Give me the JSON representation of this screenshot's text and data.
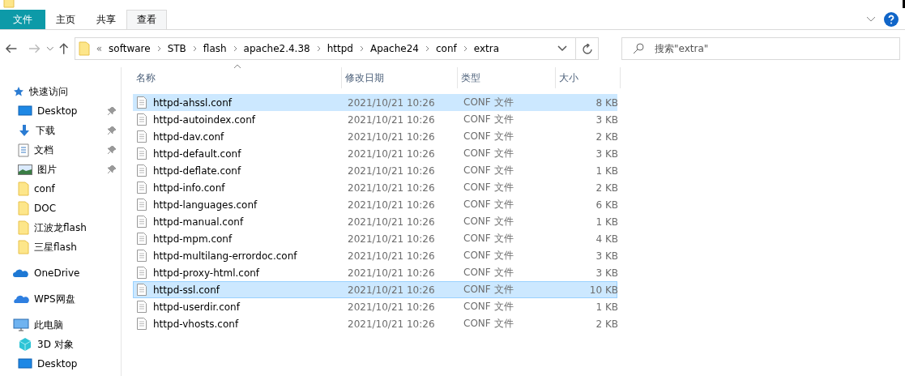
{
  "ribbon": {
    "tabs": [
      {
        "label": "文件",
        "kind": "file",
        "selected": false
      },
      {
        "label": "主页",
        "kind": "tab",
        "selected": false
      },
      {
        "label": "共享",
        "kind": "tab",
        "selected": false
      },
      {
        "label": "查看",
        "kind": "tab",
        "selected": true
      }
    ]
  },
  "address": {
    "prefix": "«",
    "path": [
      "software",
      "STB",
      "flash",
      "apache2.4.38",
      "httpd",
      "Apache24",
      "conf",
      "extra"
    ]
  },
  "search": {
    "placeholder": "搜索\"extra\""
  },
  "sidebar": {
    "groups": [
      {
        "label": "快速访问",
        "kind": "star",
        "children": [
          {
            "label": "Desktop",
            "kind": "desktop",
            "pinned": true
          },
          {
            "label": "下载",
            "kind": "download",
            "pinned": true
          },
          {
            "label": "文档",
            "kind": "document",
            "pinned": true
          },
          {
            "label": "图片",
            "kind": "picture",
            "pinned": true
          },
          {
            "label": "conf",
            "kind": "folder",
            "pinned": false
          },
          {
            "label": "DOC",
            "kind": "folder",
            "pinned": false
          },
          {
            "label": "江波龙flash",
            "kind": "folder",
            "pinned": false
          },
          {
            "label": "三星flash",
            "kind": "folder",
            "pinned": false
          }
        ]
      },
      {
        "label": "OneDrive",
        "kind": "cloud"
      },
      {
        "label": "WPS网盘",
        "kind": "cloud2"
      },
      {
        "label": "此电脑",
        "kind": "pc",
        "children": [
          {
            "label": "3D 对象",
            "kind": "cube",
            "pinned": false
          },
          {
            "label": "Desktop",
            "kind": "desktop",
            "pinned": false
          }
        ]
      }
    ]
  },
  "table": {
    "columns": [
      "名称",
      "修改日期",
      "类型",
      "大小"
    ],
    "rows": [
      {
        "name": "httpd-ahssl.conf",
        "date": "2021/10/21 10:26",
        "type": "CONF 文件",
        "size": "8 KB",
        "selected": true,
        "focused": false
      },
      {
        "name": "httpd-autoindex.conf",
        "date": "2021/10/21 10:26",
        "type": "CONF 文件",
        "size": "3 KB",
        "selected": false,
        "focused": false
      },
      {
        "name": "httpd-dav.conf",
        "date": "2021/10/21 10:26",
        "type": "CONF 文件",
        "size": "2 KB",
        "selected": false,
        "focused": false
      },
      {
        "name": "httpd-default.conf",
        "date": "2021/10/21 10:26",
        "type": "CONF 文件",
        "size": "3 KB",
        "selected": false,
        "focused": false
      },
      {
        "name": "httpd-deflate.conf",
        "date": "2021/10/21 10:26",
        "type": "CONF 文件",
        "size": "1 KB",
        "selected": false,
        "focused": false
      },
      {
        "name": "httpd-info.conf",
        "date": "2021/10/21 10:26",
        "type": "CONF 文件",
        "size": "2 KB",
        "selected": false,
        "focused": false
      },
      {
        "name": "httpd-languages.conf",
        "date": "2021/10/21 10:26",
        "type": "CONF 文件",
        "size": "6 KB",
        "selected": false,
        "focused": false
      },
      {
        "name": "httpd-manual.conf",
        "date": "2021/10/21 10:26",
        "type": "CONF 文件",
        "size": "1 KB",
        "selected": false,
        "focused": false
      },
      {
        "name": "httpd-mpm.conf",
        "date": "2021/10/21 10:26",
        "type": "CONF 文件",
        "size": "4 KB",
        "selected": false,
        "focused": false
      },
      {
        "name": "httpd-multilang-errordoc.conf",
        "date": "2021/10/21 10:26",
        "type": "CONF 文件",
        "size": "3 KB",
        "selected": false,
        "focused": false
      },
      {
        "name": "httpd-proxy-html.conf",
        "date": "2021/10/21 10:26",
        "type": "CONF 文件",
        "size": "3 KB",
        "selected": false,
        "focused": false
      },
      {
        "name": "httpd-ssl.conf",
        "date": "2021/10/21 10:26",
        "type": "CONF 文件",
        "size": "10 KB",
        "selected": true,
        "focused": true
      },
      {
        "name": "httpd-userdir.conf",
        "date": "2021/10/21 10:26",
        "type": "CONF 文件",
        "size": "1 KB",
        "selected": false,
        "focused": false
      },
      {
        "name": "httpd-vhosts.conf",
        "date": "2021/10/21 10:26",
        "type": "CONF 文件",
        "size": "2 KB",
        "selected": false,
        "focused": false
      }
    ]
  }
}
